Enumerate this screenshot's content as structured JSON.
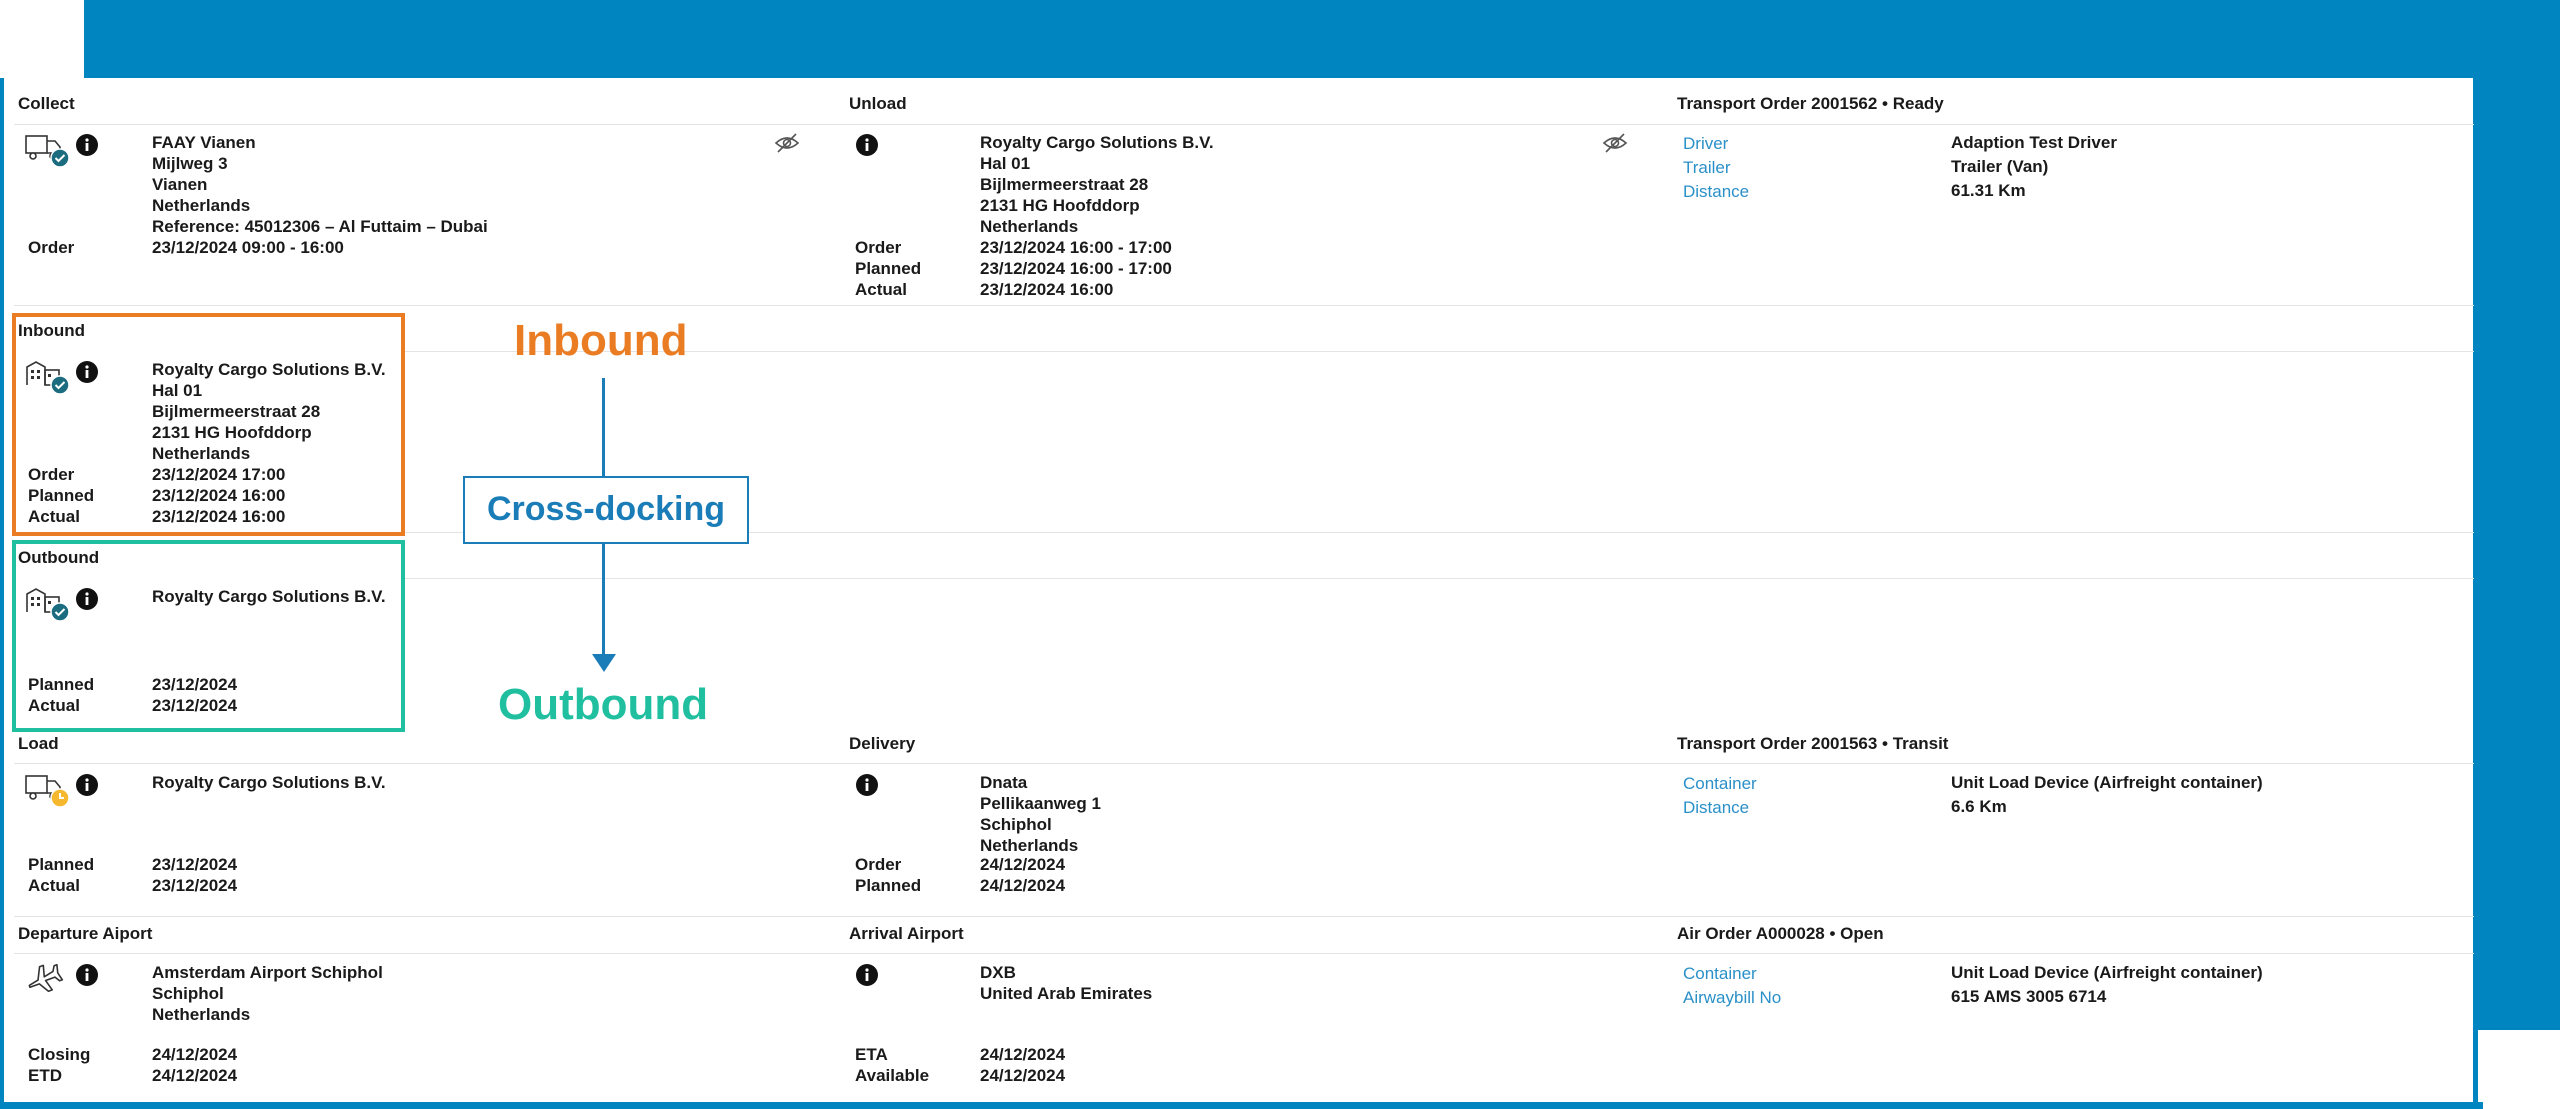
{
  "sections": {
    "collect": {
      "title": "Collect",
      "address": [
        "FAAY Vianen",
        "Mijlweg 3",
        "Vianen",
        "Netherlands",
        "Reference: 45012306 – Al Futtaim – Dubai"
      ],
      "times": [
        {
          "label": "Order",
          "value": "23/12/2024 09:00 - 16:00"
        }
      ]
    },
    "unload": {
      "title": "Unload",
      "address": [
        "Royalty Cargo Solutions B.V.",
        "Hal 01",
        "Bijlmermeerstraat 28",
        "2131 HG Hoofddorp",
        "Netherlands"
      ],
      "times": [
        {
          "label": "Order",
          "value": "23/12/2024 16:00 - 17:00"
        },
        {
          "label": "Planned",
          "value": "23/12/2024 16:00 - 17:00"
        },
        {
          "label": "Actual",
          "value": "23/12/2024 16:00"
        }
      ]
    },
    "transport_order_1": {
      "title": "Transport Order 2001562 • Ready",
      "fields": [
        {
          "label": "Driver",
          "value": "Adaption Test Driver"
        },
        {
          "label": "Trailer",
          "value": "Trailer (Van)"
        },
        {
          "label": "Distance",
          "value": "61.31 Km"
        }
      ]
    },
    "inbound": {
      "title": "Inbound",
      "address": [
        "Royalty Cargo Solutions B.V.",
        "Hal 01",
        "Bijlmermeerstraat 28",
        "2131 HG Hoofddorp",
        "Netherlands"
      ],
      "times": [
        {
          "label": "Order",
          "value": "23/12/2024 17:00"
        },
        {
          "label": "Planned",
          "value": "23/12/2024 16:00"
        },
        {
          "label": "Actual",
          "value": "23/12/2024 16:00"
        }
      ]
    },
    "outbound": {
      "title": "Outbound",
      "address": [
        "Royalty Cargo Solutions B.V."
      ],
      "times": [
        {
          "label": "Planned",
          "value": "23/12/2024"
        },
        {
          "label": "Actual",
          "value": "23/12/2024"
        }
      ]
    },
    "load": {
      "title": "Load",
      "address": [
        "Royalty Cargo Solutions B.V."
      ],
      "times": [
        {
          "label": "Planned",
          "value": "23/12/2024"
        },
        {
          "label": "Actual",
          "value": "23/12/2024"
        }
      ]
    },
    "delivery": {
      "title": "Delivery",
      "address": [
        "Dnata",
        "Pellikaanweg 1",
        "Schiphol",
        "Netherlands"
      ],
      "times": [
        {
          "label": "Order",
          "value": "24/12/2024"
        },
        {
          "label": "Planned",
          "value": "24/12/2024"
        }
      ]
    },
    "transport_order_2": {
      "title": "Transport Order 2001563 • Transit",
      "fields": [
        {
          "label": "Container",
          "value": "Unit Load Device (Airfreight container)"
        },
        {
          "label": "Distance",
          "value": "6.6 Km"
        }
      ]
    },
    "departure": {
      "title": "Departure Aiport",
      "address": [
        "Amsterdam Airport Schiphol",
        "Schiphol",
        "Netherlands"
      ],
      "times": [
        {
          "label": "Closing",
          "value": "24/12/2024"
        },
        {
          "label": "ETD",
          "value": "24/12/2024"
        }
      ]
    },
    "arrival": {
      "title": "Arrival Airport",
      "address": [
        "DXB",
        "United Arab Emirates"
      ],
      "times": [
        {
          "label": "ETA",
          "value": "24/12/2024"
        },
        {
          "label": "Available",
          "value": "24/12/2024"
        }
      ]
    },
    "air_order": {
      "title": "Air Order A000028 • Open",
      "fields": [
        {
          "label": "Container",
          "value": "Unit Load Device (Airfreight container)"
        },
        {
          "label": "Airwaybill No",
          "value": "615 AMS 3005 6714"
        }
      ]
    }
  },
  "annotations": {
    "inbound_label": "Inbound",
    "crossdocking_label": "Cross-docking",
    "outbound_label": "Outbound"
  },
  "colors": {
    "brand_blue": "#0085c0",
    "link_blue": "#2a90c8",
    "inbound_orange": "#ea7d24",
    "outbound_teal": "#1fbfa0",
    "check_teal": "#1a6c7e",
    "pending_yellow": "#f5b82e"
  }
}
